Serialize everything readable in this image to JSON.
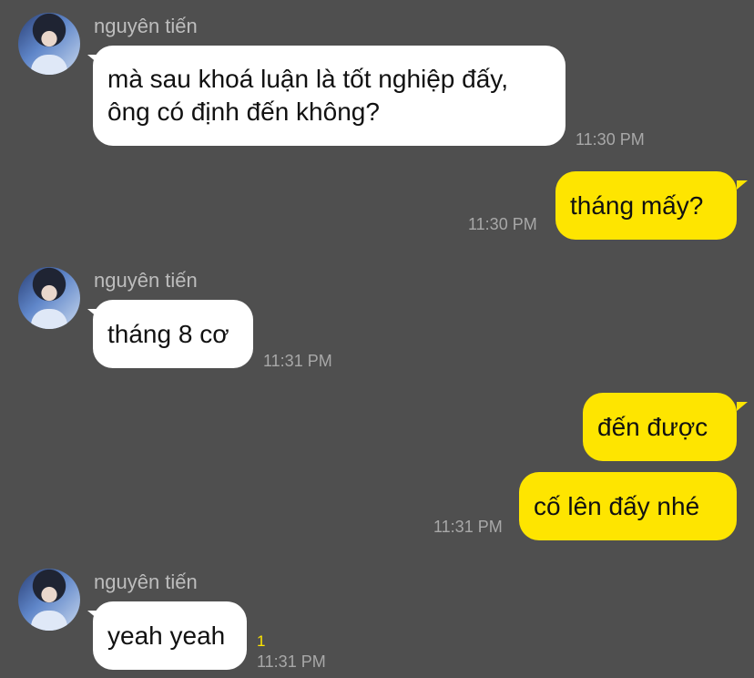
{
  "sender_name": "nguyên tiến",
  "messages": [
    {
      "from": "them",
      "lines": [
        "mà sau khoá luận là tốt nghiệp đấy,",
        "ông có định đến không?"
      ],
      "time": "11:30 PM"
    },
    {
      "from": "me",
      "lines": [
        "tháng mấy?"
      ],
      "time": "11:30 PM"
    },
    {
      "from": "them",
      "lines": [
        "tháng 8 cơ"
      ],
      "time": "11:31 PM"
    },
    {
      "from": "me",
      "lines": [
        "đến được"
      ]
    },
    {
      "from": "me",
      "lines": [
        "cố lên đấy nhé"
      ],
      "time": "11:31 PM"
    },
    {
      "from": "them",
      "lines": [
        "yeah yeah"
      ],
      "time": "11:31 PM",
      "unread": "1"
    }
  ],
  "colors": {
    "background": "#4f4f4f",
    "incoming": "#ffffff",
    "outgoing": "#fee500"
  }
}
